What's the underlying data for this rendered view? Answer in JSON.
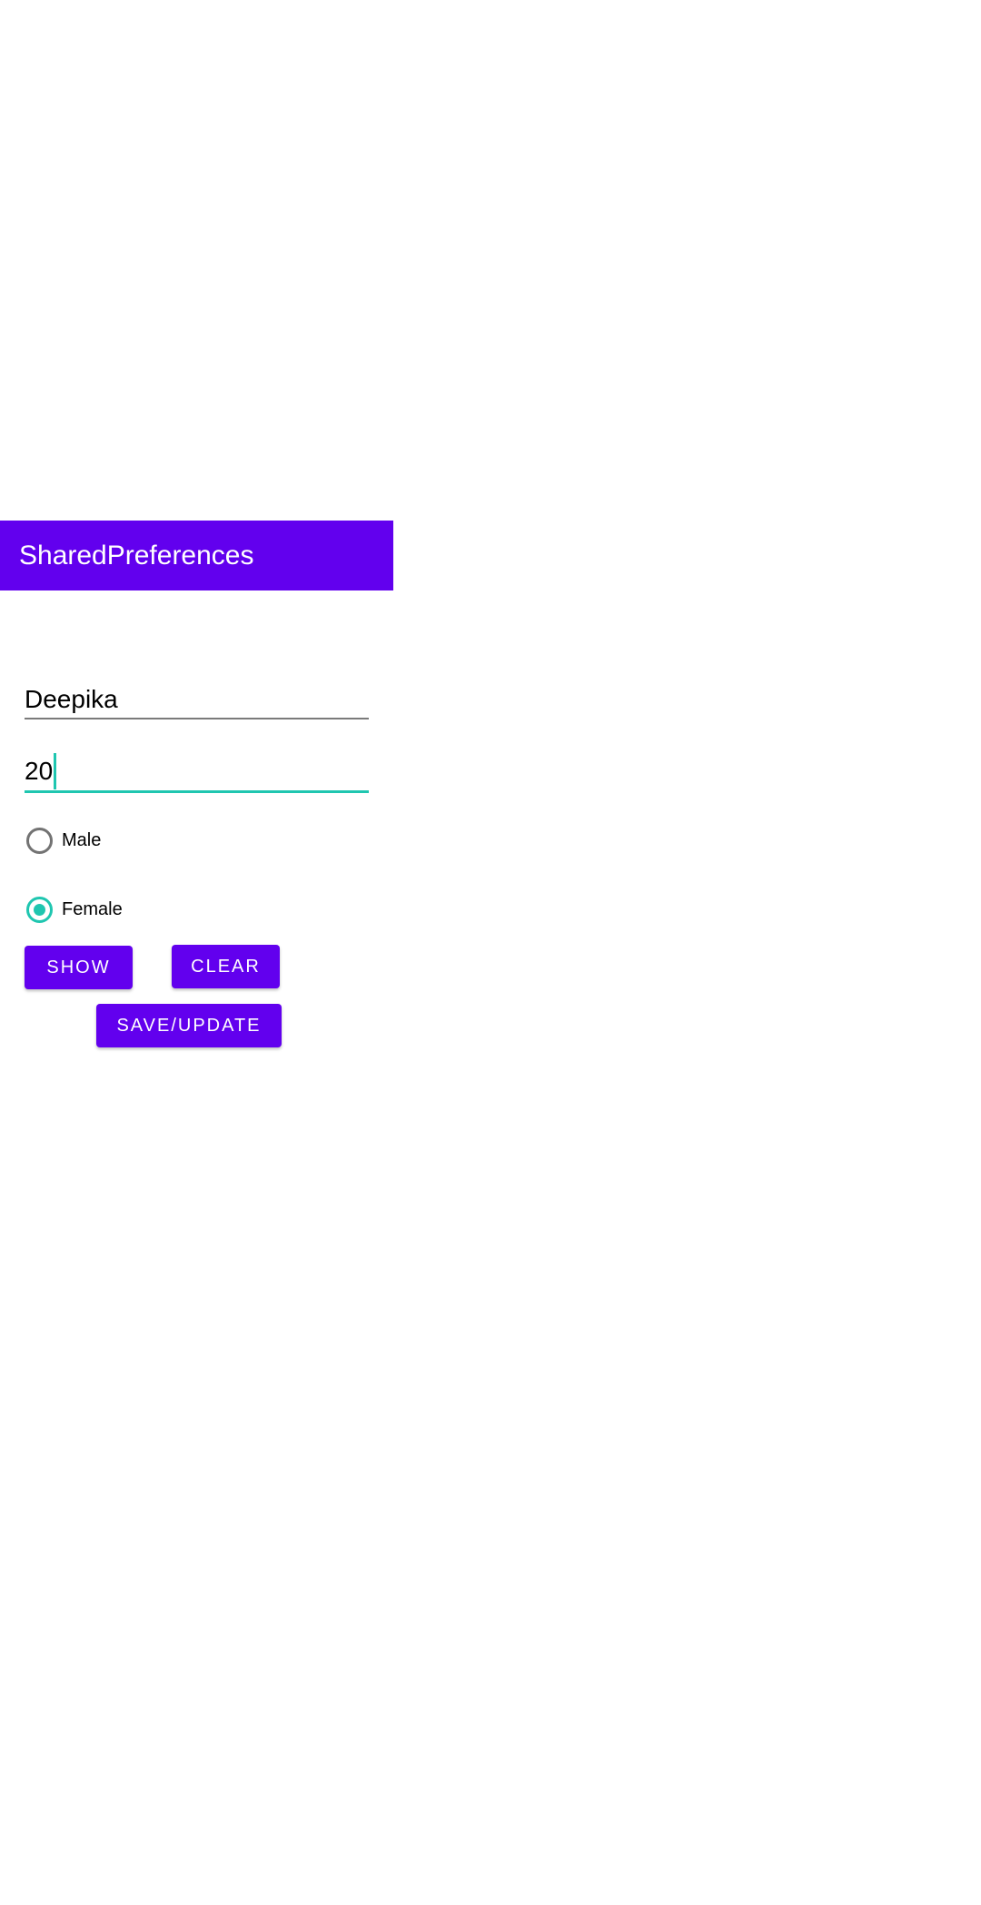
{
  "app_bar": {
    "title": "SharedPreferences",
    "color": "#6200ee"
  },
  "form": {
    "name_value": "Deepika",
    "age_value": "20",
    "accent_color": "#1fc6b0",
    "gender": {
      "options": [
        {
          "label": "Male",
          "checked": false
        },
        {
          "label": "Female",
          "checked": true
        }
      ]
    }
  },
  "buttons": {
    "show_label": "SHOW",
    "clear_label": "CLEAR",
    "save_label": "SAVE/UPDATE"
  }
}
